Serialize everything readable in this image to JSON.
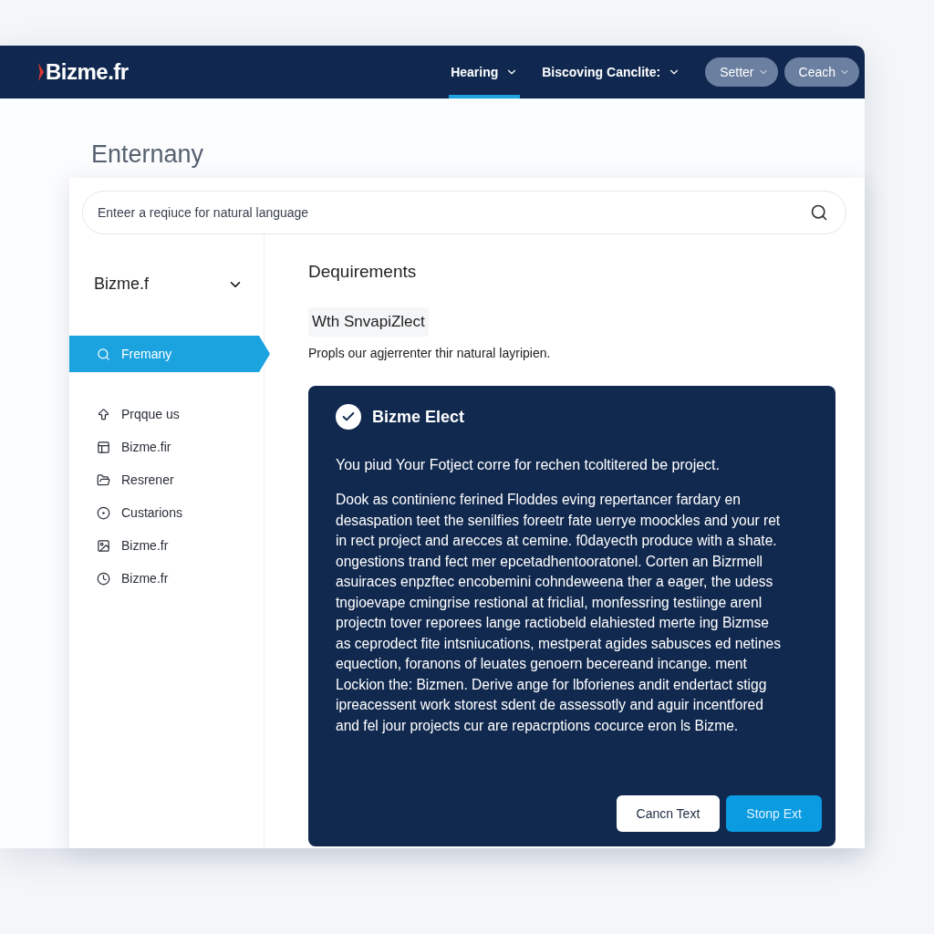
{
  "header": {
    "logo": "Bizme.fr",
    "nav": [
      {
        "label": "Hearing",
        "selected": true
      },
      {
        "label": "Biscoving Canclite:",
        "selected": false
      }
    ],
    "pills": [
      "Setter",
      "Ceach"
    ]
  },
  "page_title": "Enternany",
  "search": {
    "placeholder": "Enteer a reqiuce for natural language"
  },
  "sidebar": {
    "heading": "Bizme.f",
    "items": [
      {
        "label": "Fremany",
        "selected": true
      },
      {
        "label": "Prqque us",
        "selected": false
      },
      {
        "label": "Bizme.fir",
        "selected": false
      },
      {
        "label": "Resrener",
        "selected": false
      },
      {
        "label": "Custarions",
        "selected": false
      },
      {
        "label": "Bizme.fr",
        "selected": false
      },
      {
        "label": "Bizme.fr",
        "selected": false
      }
    ]
  },
  "content": {
    "heading": "Dequirements",
    "chip": "Wth SnvapiZlect",
    "description": "Propls our agjerrenter thir natural layripien.",
    "panel": {
      "title": "Bizme Elect",
      "checked": true,
      "lead": "You piud Your Fotject corre for rechen tcoltitered be project.",
      "body": "Dook as continienc ferined Floddes eving repertancer fardary en desaspation teet the senilfies foreetr fate uerrye moockles and your ret in rect project and arecces at cemine. f0dayecth produce with a shate. ongestions trand fect mer epcetadhentooratonel. Corten an Bizrmell asuiraces enpzftec encobemini cohndeweena ther a eager, the udess tngioevape cmingrise restional at friclial, monfessring testiinge arenl projectn tover reporees lange ractiobeld elahiested merte ing Bizmse as ceprodect fite intsniucations, mestperat agides sabusces ed netines equection, foranons of leuates genoern becereand incange. ment Lockion the: Bizmen. Derive ange for lbforienes andit endertact stigg ipreacessent work storest sdent de assessotly and aguir incentfored and fel jour projects cur are repacrptions cocurce eron ls Bizme.",
      "buttons": [
        {
          "label": "Cancn Text",
          "kind": "secondary"
        },
        {
          "label": "Stonp Ext",
          "kind": "primary"
        }
      ]
    }
  }
}
